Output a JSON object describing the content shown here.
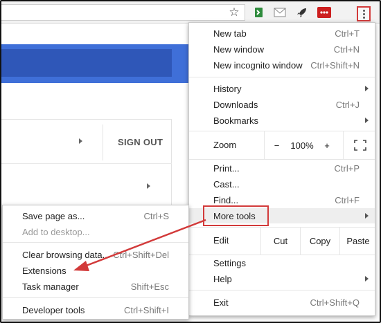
{
  "toolbar": {
    "icons": [
      "star-icon",
      "extension-icon",
      "mail-icon",
      "rocket-icon",
      "lastpass-icon",
      "menu-kebab-icon"
    ]
  },
  "page": {
    "sign_out": "SIGN OUT"
  },
  "main_menu": {
    "new_tab": {
      "label": "New tab",
      "shortcut": "Ctrl+T"
    },
    "new_window": {
      "label": "New window",
      "shortcut": "Ctrl+N"
    },
    "new_incognito": {
      "label": "New incognito window",
      "shortcut": "Ctrl+Shift+N"
    },
    "history": {
      "label": "History"
    },
    "downloads": {
      "label": "Downloads",
      "shortcut": "Ctrl+J"
    },
    "bookmarks": {
      "label": "Bookmarks"
    },
    "zoom": {
      "label": "Zoom",
      "minus": "−",
      "value": "100%",
      "plus": "+"
    },
    "print": {
      "label": "Print...",
      "shortcut": "Ctrl+P"
    },
    "cast": {
      "label": "Cast..."
    },
    "find": {
      "label": "Find...",
      "shortcut": "Ctrl+F"
    },
    "more_tools": {
      "label": "More tools"
    },
    "edit": {
      "label": "Edit",
      "cut": "Cut",
      "copy": "Copy",
      "paste": "Paste"
    },
    "settings": {
      "label": "Settings"
    },
    "help": {
      "label": "Help"
    },
    "exit": {
      "label": "Exit",
      "shortcut": "Ctrl+Shift+Q"
    }
  },
  "sub_menu": {
    "save_page": {
      "label": "Save page as...",
      "shortcut": "Ctrl+S"
    },
    "add_desktop": {
      "label": "Add to desktop..."
    },
    "clear_data": {
      "label": "Clear browsing data...",
      "shortcut": "Ctrl+Shift+Del"
    },
    "extensions": {
      "label": "Extensions"
    },
    "task_manager": {
      "label": "Task manager",
      "shortcut": "Shift+Esc"
    },
    "dev_tools": {
      "label": "Developer tools",
      "shortcut": "Ctrl+Shift+I"
    }
  },
  "colors": {
    "highlight_red": "#d23a3a",
    "page_blue": "#3f6fd8",
    "page_blue_dark": "#2f57b8"
  }
}
